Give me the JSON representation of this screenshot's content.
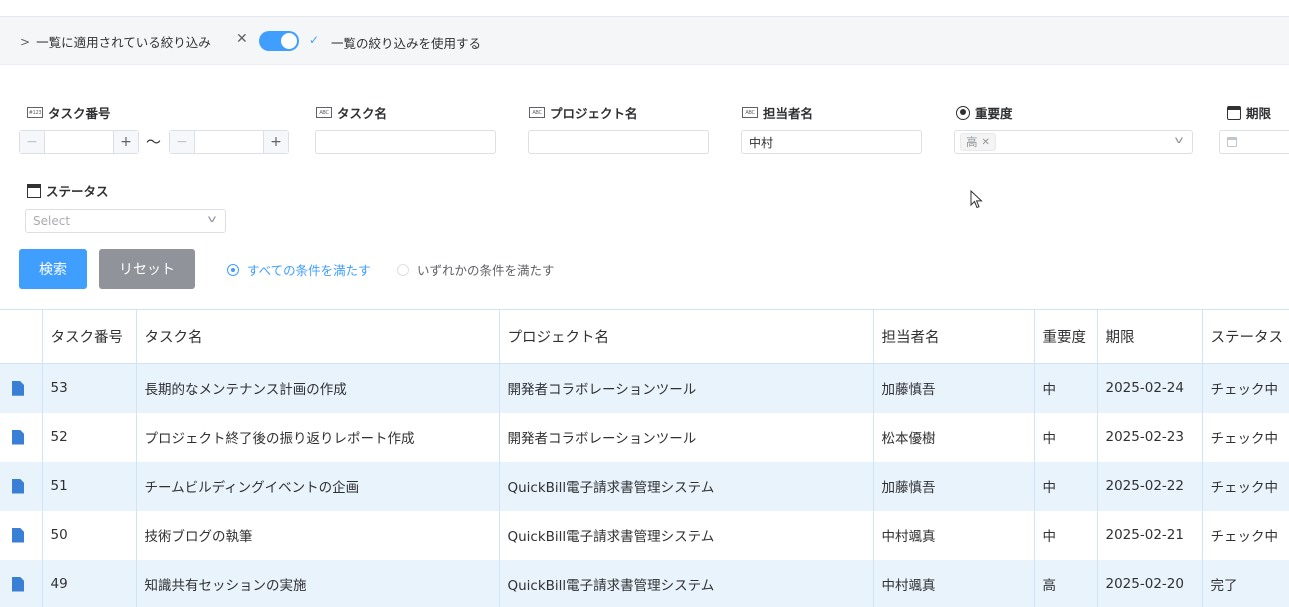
{
  "filter_bar": {
    "applied_label": "一覧に適用されている絞り込み",
    "use_filter_label": "一覧の絞り込みを使用する",
    "toggle_on": true
  },
  "fields": {
    "task_no": {
      "label": "タスク番号",
      "badge": "#123",
      "from": "",
      "to": "",
      "separator": "〜"
    },
    "task_name": {
      "label": "タスク名",
      "badge": "ABC",
      "value": ""
    },
    "project_name": {
      "label": "プロジェクト名",
      "badge": "ABC",
      "value": ""
    },
    "assignee": {
      "label": "担当者名",
      "badge": "ABC",
      "value": "中村"
    },
    "priority": {
      "label": "重要度",
      "selected_tag": "高"
    },
    "deadline": {
      "label": "期限",
      "value": ""
    },
    "status": {
      "label": "ステータス",
      "placeholder": "Select"
    }
  },
  "actions": {
    "search_label": "検索",
    "reset_label": "リセット",
    "match_all_label": "すべての条件を満たす",
    "match_any_label": "いずれかの条件を満たす",
    "match_mode": "all"
  },
  "table": {
    "columns": [
      "タスク番号",
      "タスク名",
      "プロジェクト名",
      "担当者名",
      "重要度",
      "期限",
      "ステータス"
    ],
    "rows": [
      {
        "no": "53",
        "task": "長期的なメンテナンス計画の作成",
        "project": "開発者コラボレーションツール",
        "assignee": "加藤慎吾",
        "priority": "中",
        "deadline": "2025-02-24",
        "status": "チェック中"
      },
      {
        "no": "52",
        "task": "プロジェクト終了後の振り返りレポート作成",
        "project": "開発者コラボレーションツール",
        "assignee": "松本優樹",
        "priority": "中",
        "deadline": "2025-02-23",
        "status": "チェック中"
      },
      {
        "no": "51",
        "task": "チームビルディングイベントの企画",
        "project": "QuickBill電子請求書管理システム",
        "assignee": "加藤慎吾",
        "priority": "中",
        "deadline": "2025-02-22",
        "status": "チェック中"
      },
      {
        "no": "50",
        "task": "技術ブログの執筆",
        "project": "QuickBill電子請求書管理システム",
        "assignee": "中村颯真",
        "priority": "中",
        "deadline": "2025-02-21",
        "status": "チェック中"
      },
      {
        "no": "49",
        "task": "知識共有セッションの実施",
        "project": "QuickBill電子請求書管理システム",
        "assignee": "中村颯真",
        "priority": "高",
        "deadline": "2025-02-20",
        "status": "完了"
      }
    ]
  },
  "colors": {
    "primary": "#409eff",
    "reset": "#909399",
    "row_stripe": "#e9f3fc",
    "doc_icon": "#3a7fd6"
  }
}
